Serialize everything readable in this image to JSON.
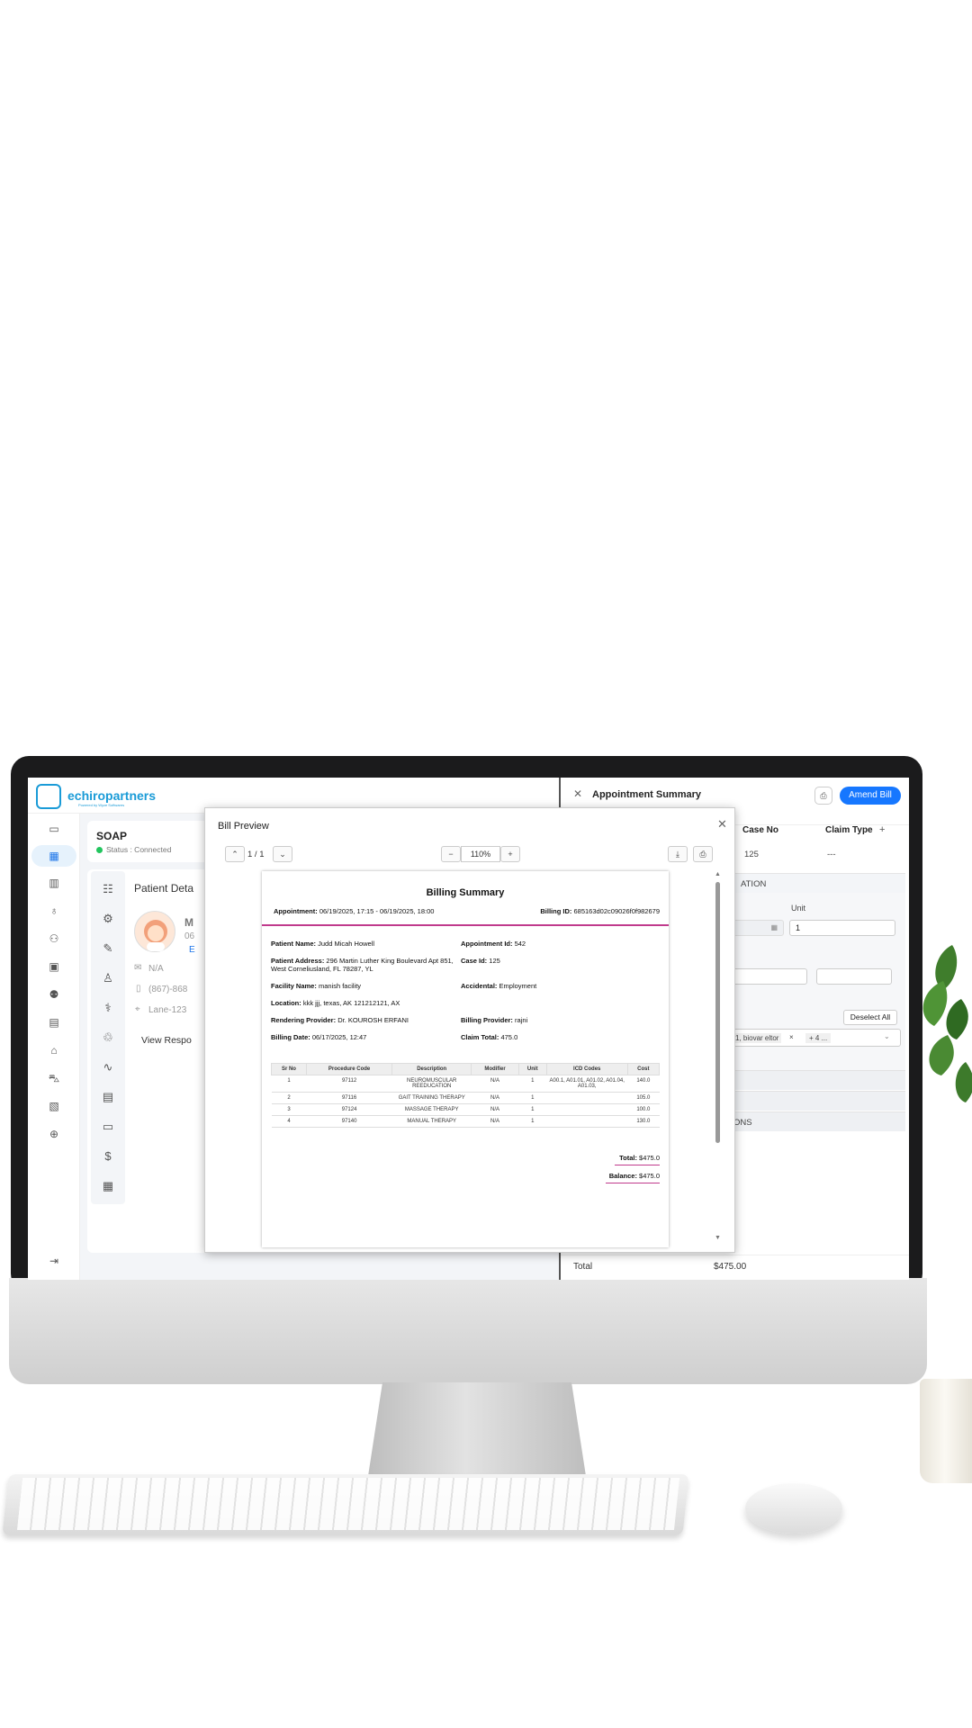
{
  "app": {
    "brand": "echiropartners",
    "brand_sub": "Powered by Wyze Softwares"
  },
  "soap": {
    "title": "SOAP",
    "status": "Status : Connected"
  },
  "patient_panel": {
    "title": "Patient Deta",
    "name_initial": "M",
    "date_fragment": "06",
    "link_fragment": "E",
    "email": "N/A",
    "phone": "(867)-868",
    "address": "Lane-123",
    "view_response": "View Respo"
  },
  "right_panel": {
    "title": "Appointment Summary",
    "amend_label": "Amend Bill",
    "col_case_no": "Case No",
    "col_claim_type": "Claim Type",
    "case_no_value": "125",
    "claim_type_value": "---",
    "section_location": "ATION",
    "unit_label": "Unit",
    "unit_value": "1",
    "deselect_label": "Deselect All",
    "tags_text": "1, biovar eltor",
    "more_tags": "+ 4 ...",
    "section_options": "ONS",
    "total_label": "Total",
    "total_value": "$475.00"
  },
  "preview": {
    "title": "Bill Preview",
    "page_indicator": "1 / 1",
    "zoom": "110%"
  },
  "bill": {
    "heading": "Billing Summary",
    "appointment_label": "Appointment:",
    "appointment_value": "06/19/2025, 17:15 - 06/19/2025, 18:00",
    "billing_id_label": "Billing ID:",
    "billing_id_value": "685163d02c09026f0f982679",
    "fields": [
      {
        "label": "Patient Name:",
        "value": "Judd Micah Howell"
      },
      {
        "label": "Appointment Id:",
        "value": "542"
      },
      {
        "label": "Patient Address:",
        "value": "296 Martin Luther King Boulevard Apt 851, West Corneliusland, FL 78287, YL"
      },
      {
        "label": "Case Id:",
        "value": "125"
      },
      {
        "label": "Facility Name:",
        "value": "manish facility"
      },
      {
        "label": "Accidental:",
        "value": "Employment"
      },
      {
        "label": "Location:",
        "value": "kkk jjj, texas, AK 121212121, AX"
      },
      {
        "label": "Rendering Provider:",
        "value": "Dr. KOUROSH ERFANI"
      },
      {
        "label": "Billing Provider:",
        "value": "rajni"
      },
      {
        "label": "Billing Date:",
        "value": "06/17/2025, 12:47"
      },
      {
        "label": "Claim Total:",
        "value": "475.0"
      }
    ],
    "columns": [
      "Sr No",
      "Procedure Code",
      "Description",
      "Modifier",
      "Unit",
      "ICD Codes",
      "Cost"
    ],
    "rows": [
      [
        "1",
        "97112",
        "NEUROMUSCULAR REEDUCATION",
        "N/A",
        "1",
        "A00.1, A01.01, A01.02, A01.04, A01.03,",
        "140.0"
      ],
      [
        "2",
        "97116",
        "GAIT TRAINING THERAPY",
        "N/A",
        "1",
        "",
        "105.0"
      ],
      [
        "3",
        "97124",
        "MASSAGE THERAPY",
        "N/A",
        "1",
        "",
        "100.0"
      ],
      [
        "4",
        "97140",
        "MANUAL THERAPY",
        "N/A",
        "1",
        "",
        "130.0"
      ]
    ],
    "total_label": "Total:",
    "total_value": "$475.0",
    "balance_label": "Balance:",
    "balance_value": "$475.0"
  }
}
